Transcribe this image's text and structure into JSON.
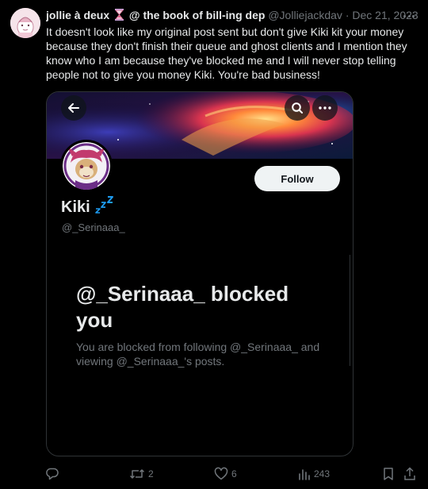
{
  "tweet": {
    "author_name": "jollie à deux",
    "author_name_suffix": "@ the book of bill-ing dep",
    "handle": "@Jolliejackdav",
    "separator": "·",
    "date": "Dec 21, 2023",
    "text": "It doesn't look like my original post sent but don't give Kiki kit your money because they don't finish their queue and ghost clients and I mention they know who I am because they've blocked me and I will never stop telling people not to give you money Kiki. You're bad business!"
  },
  "embedded_profile": {
    "display_name": "Kiki",
    "username": "@_Serinaaa_",
    "follow_label": "Follow",
    "blocked_title": "@_Serinaaa_ blocked you",
    "blocked_description": "You are blocked from following @_Serinaaa_ and viewing @_Serinaaa_'s posts."
  },
  "actions": {
    "reply_count": "",
    "retweet_count": "2",
    "like_count": "6",
    "view_count": "243"
  },
  "icons": [
    "more-icon",
    "back-arrow-icon",
    "search-icon",
    "more-icon",
    "reply-icon",
    "retweet-icon",
    "like-icon",
    "views-icon",
    "bookmark-icon",
    "share-icon"
  ],
  "colors": {
    "background": "#000000",
    "text_primary": "#e7e9ea",
    "text_secondary": "#71767b",
    "border": "#2f3336",
    "follow_button_bg": "#eff3f4",
    "zzz_blue": "#1d9bf0"
  }
}
